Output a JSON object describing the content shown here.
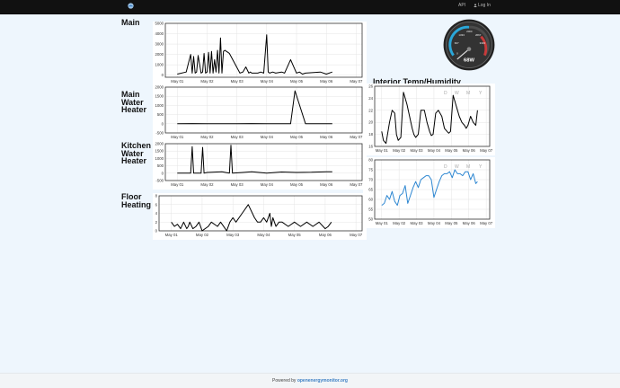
{
  "header": {
    "api_label": "API",
    "login_label": "Log In"
  },
  "left_labels": {
    "main": "Main",
    "water_heater": [
      "Main",
      "Water",
      "Heater"
    ],
    "kitchen": [
      "Kitchen",
      "Water",
      "Heater"
    ],
    "floor": [
      "Floor",
      "Heating"
    ]
  },
  "right_title": "Interior Temp/Humidity",
  "gauge": {
    "reading": "68W",
    "ticks": [
      "0",
      "667",
      "1333",
      "2000",
      "2667",
      "3333"
    ],
    "value_w": 68,
    "max_w": 4000
  },
  "range_buttons": [
    "D",
    "W",
    "M",
    "Y"
  ],
  "footer": {
    "prefix": "Powered by ",
    "link": "openenergymonitor.org"
  },
  "colors": {
    "line_black": "#000000",
    "line_blue": "#2c86d1",
    "background": "#eef6fd",
    "topbar": "#111111"
  },
  "chart_data": [
    {
      "name": "main",
      "type": "line",
      "x_ticks": [
        "May 01",
        "May 02",
        "May 03",
        "May 04",
        "May 05",
        "May 06",
        "May 07"
      ],
      "y_ticks": [
        "0",
        "1000",
        "2000",
        "3000",
        "4000",
        "5000"
      ],
      "ylim": [
        -200,
        5000
      ],
      "x": [
        0.0,
        0.3,
        0.45,
        0.5,
        0.55,
        0.6,
        0.65,
        0.7,
        0.8,
        0.85,
        0.9,
        0.95,
        1.0,
        1.05,
        1.1,
        1.15,
        1.2,
        1.25,
        1.3,
        1.35,
        1.4,
        1.45,
        1.5,
        1.55,
        1.6,
        1.65,
        1.7,
        1.75,
        2.1,
        2.2,
        2.3,
        2.4,
        2.45,
        2.5,
        2.6,
        2.7,
        2.8,
        2.9,
        3.0,
        3.05,
        3.1,
        3.2,
        3.3,
        3.5,
        3.6,
        3.8,
        4.0,
        4.1,
        4.2,
        4.3,
        4.8,
        5.0,
        5.2
      ],
      "y": [
        100,
        300,
        2000,
        200,
        1800,
        200,
        300,
        1900,
        200,
        300,
        2100,
        200,
        300,
        2200,
        200,
        2300,
        200,
        1500,
        300,
        2400,
        200,
        3600,
        200,
        2300,
        2400,
        2300,
        2200,
        2100,
        200,
        300,
        800,
        200,
        300,
        200,
        200,
        200,
        300,
        200,
        3900,
        300,
        200,
        300,
        200,
        300,
        200,
        1500,
        200,
        300,
        100,
        200,
        300,
        100,
        300
      ]
    },
    {
      "name": "main_water_heater",
      "type": "line",
      "x_ticks": [
        "May 01",
        "May 02",
        "May 03",
        "May 04",
        "May 05",
        "May 06",
        "May 07"
      ],
      "y_ticks": [
        "-500",
        "0",
        "500",
        "1000",
        "1500",
        "2000"
      ],
      "ylim": [
        -500,
        2000
      ],
      "x": [
        0.0,
        0.5,
        1.0,
        1.5,
        2.0,
        2.5,
        3.0,
        3.5,
        3.8,
        3.95,
        4.3,
        4.8,
        5.2
      ],
      "y": [
        0,
        10,
        0,
        5,
        0,
        10,
        0,
        5,
        0,
        1800,
        0,
        0,
        0
      ]
    },
    {
      "name": "kitchen_water_heater",
      "type": "line",
      "x_ticks": [
        "May 01",
        "May 02",
        "May 03",
        "May 04",
        "May 05",
        "May 06",
        "May 07"
      ],
      "y_ticks": [
        "-500",
        "0",
        "500",
        "1000",
        "1500",
        "2000"
      ],
      "ylim": [
        -500,
        2000
      ],
      "x": [
        0.0,
        0.45,
        0.5,
        0.55,
        0.8,
        0.85,
        0.9,
        1.0,
        1.5,
        1.75,
        1.8,
        1.85,
        2.2,
        2.5,
        3.0,
        3.5,
        4.0,
        4.5,
        5.0,
        5.2
      ],
      "y": [
        0,
        0,
        1800,
        0,
        0,
        1750,
        0,
        50,
        100,
        0,
        1900,
        0,
        50,
        100,
        0,
        80,
        50,
        60,
        100,
        90
      ]
    },
    {
      "name": "floor_heating",
      "type": "line",
      "x_ticks": [
        "May 01",
        "May 02",
        "May 03",
        "May 04",
        "May 05",
        "May 06",
        "May 07"
      ],
      "y_ticks": [
        "0",
        "2",
        "4",
        "6",
        "8"
      ],
      "ylim": [
        0,
        8
      ],
      "x": [
        0.0,
        0.1,
        0.2,
        0.3,
        0.4,
        0.5,
        0.55,
        0.6,
        0.7,
        0.8,
        0.9,
        1.0,
        1.2,
        1.3,
        1.5,
        1.6,
        1.7,
        1.8,
        1.9,
        2.0,
        2.1,
        2.3,
        2.5,
        2.7,
        2.8,
        2.9,
        3.0,
        3.1,
        3.2,
        3.25,
        3.3,
        3.4,
        3.5,
        3.6,
        3.8,
        4.0,
        4.2,
        4.4,
        4.6,
        4.8,
        5.0,
        5.1,
        5.2
      ],
      "y": [
        2,
        1,
        1.5,
        0.5,
        2,
        0.5,
        1,
        2,
        0.5,
        1,
        2,
        0,
        1,
        2,
        1,
        2,
        1,
        0,
        2,
        3,
        2,
        4,
        6,
        3,
        2,
        2,
        3,
        2,
        4,
        1,
        3,
        1,
        2,
        2,
        1,
        2,
        1,
        2,
        1,
        2,
        0.5,
        1,
        2
      ]
    },
    {
      "name": "interior_temp",
      "type": "line",
      "x_ticks": [
        "May 01",
        "May 02",
        "May 03",
        "May 04",
        "May 05",
        "May 06",
        "May 07"
      ],
      "y_ticks": [
        "16",
        "18",
        "20",
        "22",
        "24",
        "26"
      ],
      "ylim": [
        16,
        26
      ],
      "x": [
        0.0,
        0.1,
        0.25,
        0.45,
        0.6,
        0.75,
        0.85,
        0.95,
        1.1,
        1.25,
        1.45,
        1.6,
        1.75,
        1.85,
        1.95,
        2.1,
        2.25,
        2.45,
        2.6,
        2.75,
        2.85,
        2.95,
        3.1,
        3.25,
        3.45,
        3.6,
        3.75,
        3.85,
        3.95,
        4.1,
        4.25,
        4.45,
        4.6,
        4.75,
        4.85,
        4.95,
        5.1,
        5.25,
        5.4,
        5.5
      ],
      "y": [
        18.5,
        17,
        16.5,
        20,
        22,
        21.5,
        18,
        17,
        17.5,
        25,
        23,
        21,
        19,
        18,
        17.5,
        18,
        22,
        22,
        20,
        18.5,
        17.8,
        18,
        21.5,
        22,
        21,
        19,
        18.5,
        18.2,
        18.5,
        24.5,
        23,
        21,
        20,
        19.5,
        19,
        19.5,
        21,
        20,
        19.5,
        22
      ]
    },
    {
      "name": "interior_humidity",
      "type": "line",
      "x_ticks": [
        "May 01",
        "May 02",
        "May 03",
        "May 04",
        "May 05",
        "May 06",
        "May 07"
      ],
      "y_ticks": [
        "50",
        "55",
        "60",
        "65",
        "70",
        "75",
        "80"
      ],
      "ylim": [
        50,
        80
      ],
      "x": [
        0.0,
        0.15,
        0.3,
        0.45,
        0.6,
        0.75,
        0.9,
        1.05,
        1.2,
        1.35,
        1.5,
        1.65,
        1.8,
        1.95,
        2.1,
        2.25,
        2.4,
        2.55,
        2.7,
        2.85,
        3.0,
        3.15,
        3.3,
        3.45,
        3.6,
        3.75,
        3.9,
        4.05,
        4.2,
        4.35,
        4.5,
        4.65,
        4.8,
        4.95,
        5.1,
        5.25,
        5.4,
        5.5
      ],
      "y": [
        57,
        58,
        62,
        60,
        64,
        59,
        57,
        62,
        63,
        67,
        58,
        62,
        66,
        69,
        66,
        70,
        71,
        72,
        72,
        70,
        61,
        65,
        69,
        72,
        73,
        73,
        74,
        71,
        75,
        73,
        73,
        72,
        74,
        74,
        70,
        73,
        68,
        69
      ]
    }
  ]
}
